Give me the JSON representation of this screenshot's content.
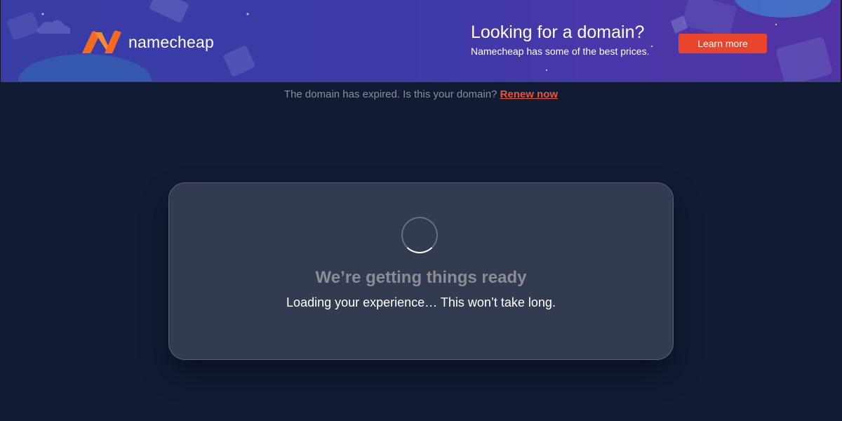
{
  "banner": {
    "brand": "namecheap",
    "title": "Looking for a domain?",
    "subtitle": "Namecheap has some of the best prices.",
    "button_label": "Learn more",
    "colors": {
      "brand_orange": "#f26b21",
      "button": "#e8452c",
      "background": "#3b3aa8"
    }
  },
  "notice": {
    "text": "The domain has expired. Is this your domain?",
    "link_label": "Renew now"
  },
  "card": {
    "title": "We’re getting things ready",
    "subtitle": "Loading your experience… This won’t take long.",
    "icon": "loading-spinner-icon"
  },
  "colors": {
    "page_background": "#111b34",
    "card_background": "#323b4f",
    "link": "#e8553c"
  }
}
